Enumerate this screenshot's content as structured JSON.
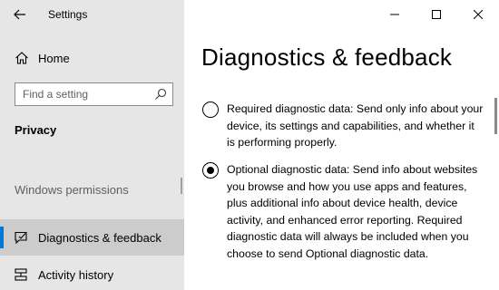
{
  "window": {
    "app_title": "Settings"
  },
  "sidebar": {
    "home_label": "Home",
    "search_placeholder": "Find a setting",
    "section_label": "Privacy",
    "group_label": "Windows permissions",
    "items": [
      {
        "label": "Diagnostics & feedback",
        "icon": "chat-feedback-icon",
        "selected": true
      },
      {
        "label": "Activity history",
        "icon": "activity-history-icon",
        "selected": false
      }
    ]
  },
  "main": {
    "page_title": "Diagnostics & feedback",
    "options": [
      {
        "label": "Required diagnostic data: Send only info about your device, its settings and capabilities, and whether it is performing properly.",
        "checked": false
      },
      {
        "label": "Optional diagnostic data: Send info about websites you browse and how you use apps and features, plus additional info about device health, device activity, and enhanced error reporting. Required diagnostic data will always be included when you choose to send Optional diagnostic data.",
        "checked": true
      }
    ]
  },
  "colors": {
    "sidebar_bg": "#e6e6e6",
    "selected_bg": "#cccccc",
    "accent": "#0078d7"
  }
}
